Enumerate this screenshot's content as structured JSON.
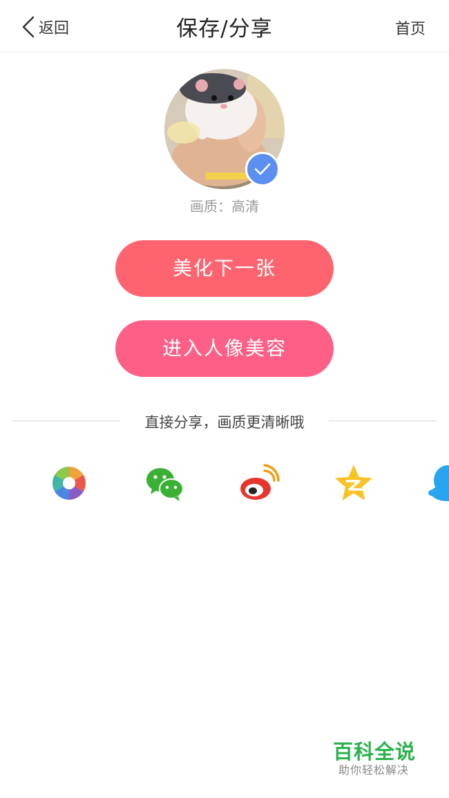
{
  "header": {
    "back_label": "返回",
    "title": "保存/分享",
    "home_label": "首页"
  },
  "image": {
    "quality_label": "画质：高清",
    "selected_icon": "check-icon",
    "colors": {
      "badge": "#5b8ff0"
    }
  },
  "actions": {
    "next_label": "美化下一张",
    "beauty_label": "进入人像美容",
    "colors": {
      "next": "#fe6470",
      "beauty": "#fe5f86"
    }
  },
  "share": {
    "heading": "直接分享，画质更清晰哦",
    "targets": [
      {
        "icon": "camera-aperture-icon"
      },
      {
        "icon": "wechat-icon"
      },
      {
        "icon": "weibo-icon"
      },
      {
        "icon": "qzone-star-icon"
      },
      {
        "icon": "qq-penguin-icon"
      }
    ]
  },
  "watermark": {
    "title": "百科全说",
    "subtitle": "助你轻松解决"
  }
}
